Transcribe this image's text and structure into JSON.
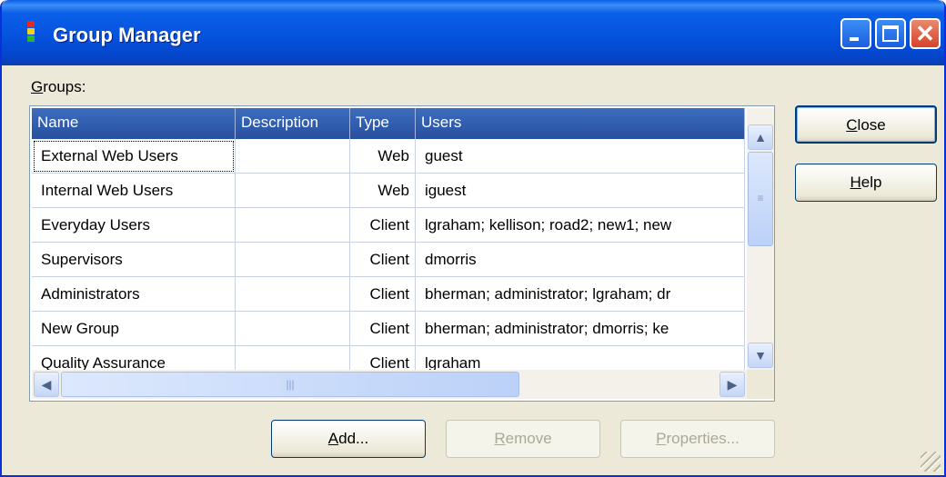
{
  "window": {
    "title": "Group Manager",
    "controls": {
      "minimize": "minimize-icon",
      "maximize": "maximize-icon",
      "close": "close-icon"
    }
  },
  "groups_label": {
    "accel": "G",
    "rest": "roups:"
  },
  "listview": {
    "columns": [
      "Name",
      "Description",
      "Type",
      "Users"
    ],
    "rows": [
      {
        "name": "External Web Users",
        "description": "",
        "type": "Web",
        "users": "guest"
      },
      {
        "name": "Internal Web Users",
        "description": "",
        "type": "Web",
        "users": "iguest"
      },
      {
        "name": "Everyday Users",
        "description": "",
        "type": "Client",
        "users": "lgraham; kellison; road2; new1; new"
      },
      {
        "name": "Supervisors",
        "description": "",
        "type": "Client",
        "users": "dmorris"
      },
      {
        "name": "Administrators",
        "description": "",
        "type": "Client",
        "users": "bherman; administrator; lgraham; dr"
      },
      {
        "name": "New Group",
        "description": "",
        "type": "Client",
        "users": "bherman; administrator; dmorris; ke"
      },
      {
        "name": "Quality Assurance",
        "description": "",
        "type": "Client",
        "users": "lgraham"
      }
    ]
  },
  "buttons": {
    "close": {
      "accel": "C",
      "rest": "lose"
    },
    "help": {
      "accel": "H",
      "rest": "elp"
    },
    "add": {
      "accel": "A",
      "rest": "dd..."
    },
    "remove": {
      "accel": "R",
      "rest": "emove"
    },
    "properties": {
      "accel": "P",
      "rest": "roperties..."
    }
  },
  "colors": {
    "titlebar": "#0553de",
    "header": "#2e5aa8",
    "dialog_bg": "#ece9d8",
    "close_button": "#d6422a"
  }
}
